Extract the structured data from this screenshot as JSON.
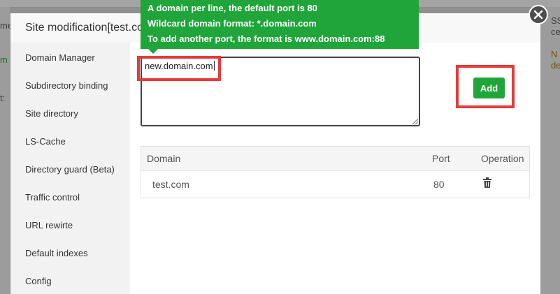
{
  "background": {
    "left_fragments": [
      "me",
      "m",
      "t:"
    ],
    "right_fragments": [
      "SS",
      "ce",
      "N",
      "de"
    ]
  },
  "modal": {
    "title": "Site modification[test.com",
    "close_icon": "close-icon"
  },
  "sidebar": {
    "items": [
      {
        "label": "Domain Manager",
        "active": true
      },
      {
        "label": "Subdirectory binding"
      },
      {
        "label": "Site directory"
      },
      {
        "label": "LS-Cache"
      },
      {
        "label": "Directory guard (Beta)"
      },
      {
        "label": "Traffic control"
      },
      {
        "label": "URL rewirte"
      },
      {
        "label": "Default indexes"
      },
      {
        "label": "Config"
      }
    ]
  },
  "tooltip": {
    "lines": [
      "A domain per line, the default port is 80",
      "Wildcard domain format: *.domain.com",
      "To add another port, the format is www.domain.com:88"
    ]
  },
  "domain_input": {
    "value": "new.domain.com"
  },
  "add_button": {
    "label": "Add"
  },
  "table": {
    "headers": [
      "Domain",
      "Port",
      "Operation"
    ],
    "rows": [
      {
        "domain": "test.com",
        "port": "80",
        "operation_icon": "trash-icon"
      }
    ]
  },
  "colors": {
    "accent_green": "#20a53a",
    "highlight_red": "#e53b3b",
    "background_warning_orange": "#c77a00"
  }
}
